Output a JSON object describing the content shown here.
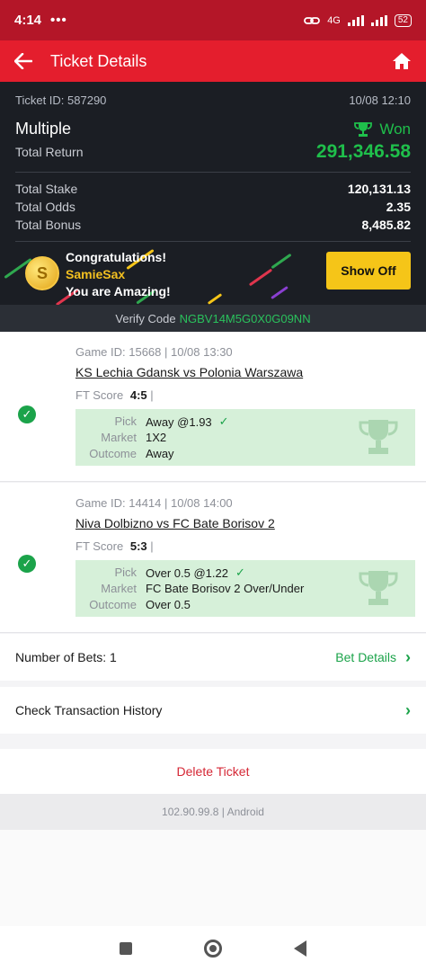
{
  "status_bar": {
    "time": "4:14",
    "dots": "•••",
    "network": "4G",
    "battery": "52"
  },
  "app_bar": {
    "title": "Ticket Details"
  },
  "ticket": {
    "id_label": "Ticket ID: 587290",
    "datetime": "10/08 12:10",
    "type": "Multiple",
    "status": "Won",
    "return_label": "Total Return",
    "return_value": "291,346.58",
    "stake_label": "Total Stake",
    "stake_value": "120,131.13",
    "odds_label": "Total Odds",
    "odds_value": "2.35",
    "bonus_label": "Total Bonus",
    "bonus_value": "8,485.82"
  },
  "promo": {
    "line1": "Congratulations!",
    "username": "SamieSax",
    "line3": "You are Amazing!",
    "button": "Show Off",
    "coin_symbol": "S"
  },
  "verify": {
    "label": "Verify Code",
    "code": "NGBV14M5G0X0G09NN"
  },
  "games": [
    {
      "info": "Game ID: 15668 | 10/08 13:30",
      "match": "KS Lechia Gdansk vs Polonia Warszawa",
      "score_label": "FT Score",
      "score": "4:5",
      "score_sep": "|",
      "pick_label": "Pick",
      "pick": "Away @1.93",
      "market_label": "Market",
      "market": "1X2",
      "outcome_label": "Outcome",
      "outcome": "Away"
    },
    {
      "info": "Game ID: 14414 | 10/08 14:00",
      "match": "Niva Dolbizno vs FC Bate Borisov 2",
      "score_label": "FT Score",
      "score": "5:3",
      "score_sep": "|",
      "pick_label": "Pick",
      "pick": "Over 0.5 @1.22",
      "market_label": "Market",
      "market": "FC Bate Borisov 2 Over/Under",
      "outcome_label": "Outcome",
      "outcome": "Over 0.5"
    }
  ],
  "bets": {
    "label": "Number of Bets: 1",
    "link": "Bet Details"
  },
  "history": {
    "label": "Check Transaction History"
  },
  "delete_label": "Delete Ticket",
  "version": "102.90.99.8 | Android",
  "colors": {
    "brand_red": "#e41e2d",
    "won_green": "#1fbf4b",
    "promo_yellow": "#f5c518"
  }
}
